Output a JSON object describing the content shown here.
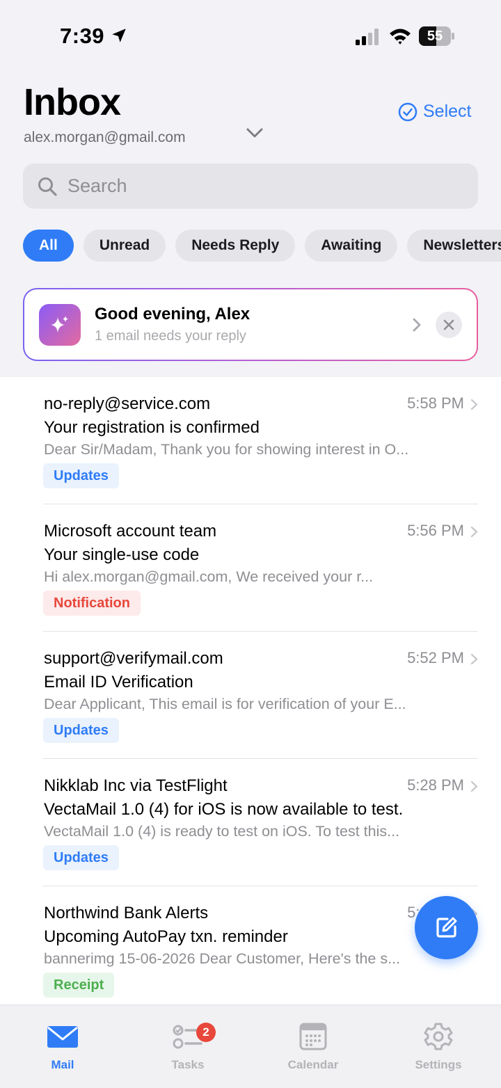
{
  "status_bar": {
    "time": "7:39",
    "battery": "55",
    "battery_level": 0.55
  },
  "header": {
    "title": "Inbox",
    "account_email": "alex.morgan@gmail.com",
    "select_label": "Select"
  },
  "search": {
    "placeholder": "Search"
  },
  "filters": [
    "All",
    "Unread",
    "Needs Reply",
    "Awaiting",
    "Newsletters"
  ],
  "greeting": {
    "title": "Good evening, Alex",
    "subtitle": "1 email needs your reply"
  },
  "emails": [
    {
      "sender": "no-reply@service.com",
      "time": "5:58 PM",
      "subject": "Your registration is confirmed",
      "preview": "Dear Sir/Madam, Thank you for showing interest in O...",
      "tag": "Updates"
    },
    {
      "sender": "Microsoft account team",
      "time": "5:56 PM",
      "subject": "Your single-use code",
      "preview": "Hi alex.morgan@gmail.com, We received your r...",
      "tag": "Notification"
    },
    {
      "sender": "support@verifymail.com",
      "time": "5:52 PM",
      "subject": "Email ID Verification",
      "preview": "Dear Applicant, This email is for verification of your E...",
      "tag": "Updates"
    },
    {
      "sender": "Nikklab Inc via TestFlight",
      "time": "5:28 PM",
      "subject": "VectaMail 1.0 (4) for iOS is now available to test.",
      "preview": "VectaMail 1.0 (4) is ready to test on iOS. To test this...",
      "tag": "Updates"
    },
    {
      "sender": "Northwind Bank Alerts",
      "time": "5:27 PM",
      "subject": "Upcoming AutoPay txn. reminder",
      "preview": "bannerimg 15-06-2026 Dear Customer, Here's the s...",
      "tag": "Receipt"
    }
  ],
  "tab_bar": {
    "tabs": [
      {
        "label": "Mail",
        "icon": "envelope-icon"
      },
      {
        "label": "Tasks",
        "icon": "checklist-icon",
        "badge": "2"
      },
      {
        "label": "Calendar",
        "icon": "calendar-icon"
      },
      {
        "label": "Settings",
        "icon": "gear-icon"
      }
    ]
  },
  "colors": {
    "accent": "#2f7cf6",
    "background": "#f2f2f7",
    "badge_red": "#e8473b"
  }
}
